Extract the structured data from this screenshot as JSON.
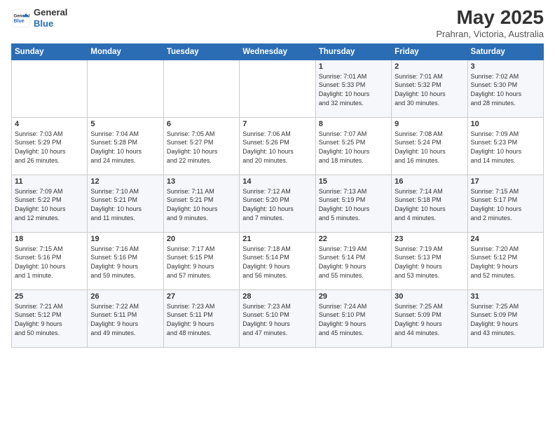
{
  "header": {
    "logo_general": "General",
    "logo_blue": "Blue",
    "month_title": "May 2025",
    "location": "Prahran, Victoria, Australia"
  },
  "days_of_week": [
    "Sunday",
    "Monday",
    "Tuesday",
    "Wednesday",
    "Thursday",
    "Friday",
    "Saturday"
  ],
  "weeks": [
    [
      {
        "day": "",
        "info": ""
      },
      {
        "day": "",
        "info": ""
      },
      {
        "day": "",
        "info": ""
      },
      {
        "day": "",
        "info": ""
      },
      {
        "day": "1",
        "info": "Sunrise: 7:01 AM\nSunset: 5:33 PM\nDaylight: 10 hours\nand 32 minutes."
      },
      {
        "day": "2",
        "info": "Sunrise: 7:01 AM\nSunset: 5:32 PM\nDaylight: 10 hours\nand 30 minutes."
      },
      {
        "day": "3",
        "info": "Sunrise: 7:02 AM\nSunset: 5:30 PM\nDaylight: 10 hours\nand 28 minutes."
      }
    ],
    [
      {
        "day": "4",
        "info": "Sunrise: 7:03 AM\nSunset: 5:29 PM\nDaylight: 10 hours\nand 26 minutes."
      },
      {
        "day": "5",
        "info": "Sunrise: 7:04 AM\nSunset: 5:28 PM\nDaylight: 10 hours\nand 24 minutes."
      },
      {
        "day": "6",
        "info": "Sunrise: 7:05 AM\nSunset: 5:27 PM\nDaylight: 10 hours\nand 22 minutes."
      },
      {
        "day": "7",
        "info": "Sunrise: 7:06 AM\nSunset: 5:26 PM\nDaylight: 10 hours\nand 20 minutes."
      },
      {
        "day": "8",
        "info": "Sunrise: 7:07 AM\nSunset: 5:25 PM\nDaylight: 10 hours\nand 18 minutes."
      },
      {
        "day": "9",
        "info": "Sunrise: 7:08 AM\nSunset: 5:24 PM\nDaylight: 10 hours\nand 16 minutes."
      },
      {
        "day": "10",
        "info": "Sunrise: 7:09 AM\nSunset: 5:23 PM\nDaylight: 10 hours\nand 14 minutes."
      }
    ],
    [
      {
        "day": "11",
        "info": "Sunrise: 7:09 AM\nSunset: 5:22 PM\nDaylight: 10 hours\nand 12 minutes."
      },
      {
        "day": "12",
        "info": "Sunrise: 7:10 AM\nSunset: 5:21 PM\nDaylight: 10 hours\nand 11 minutes."
      },
      {
        "day": "13",
        "info": "Sunrise: 7:11 AM\nSunset: 5:21 PM\nDaylight: 10 hours\nand 9 minutes."
      },
      {
        "day": "14",
        "info": "Sunrise: 7:12 AM\nSunset: 5:20 PM\nDaylight: 10 hours\nand 7 minutes."
      },
      {
        "day": "15",
        "info": "Sunrise: 7:13 AM\nSunset: 5:19 PM\nDaylight: 10 hours\nand 5 minutes."
      },
      {
        "day": "16",
        "info": "Sunrise: 7:14 AM\nSunset: 5:18 PM\nDaylight: 10 hours\nand 4 minutes."
      },
      {
        "day": "17",
        "info": "Sunrise: 7:15 AM\nSunset: 5:17 PM\nDaylight: 10 hours\nand 2 minutes."
      }
    ],
    [
      {
        "day": "18",
        "info": "Sunrise: 7:15 AM\nSunset: 5:16 PM\nDaylight: 10 hours\nand 1 minute."
      },
      {
        "day": "19",
        "info": "Sunrise: 7:16 AM\nSunset: 5:16 PM\nDaylight: 9 hours\nand 59 minutes."
      },
      {
        "day": "20",
        "info": "Sunrise: 7:17 AM\nSunset: 5:15 PM\nDaylight: 9 hours\nand 57 minutes."
      },
      {
        "day": "21",
        "info": "Sunrise: 7:18 AM\nSunset: 5:14 PM\nDaylight: 9 hours\nand 56 minutes."
      },
      {
        "day": "22",
        "info": "Sunrise: 7:19 AM\nSunset: 5:14 PM\nDaylight: 9 hours\nand 55 minutes."
      },
      {
        "day": "23",
        "info": "Sunrise: 7:19 AM\nSunset: 5:13 PM\nDaylight: 9 hours\nand 53 minutes."
      },
      {
        "day": "24",
        "info": "Sunrise: 7:20 AM\nSunset: 5:12 PM\nDaylight: 9 hours\nand 52 minutes."
      }
    ],
    [
      {
        "day": "25",
        "info": "Sunrise: 7:21 AM\nSunset: 5:12 PM\nDaylight: 9 hours\nand 50 minutes."
      },
      {
        "day": "26",
        "info": "Sunrise: 7:22 AM\nSunset: 5:11 PM\nDaylight: 9 hours\nand 49 minutes."
      },
      {
        "day": "27",
        "info": "Sunrise: 7:23 AM\nSunset: 5:11 PM\nDaylight: 9 hours\nand 48 minutes."
      },
      {
        "day": "28",
        "info": "Sunrise: 7:23 AM\nSunset: 5:10 PM\nDaylight: 9 hours\nand 47 minutes."
      },
      {
        "day": "29",
        "info": "Sunrise: 7:24 AM\nSunset: 5:10 PM\nDaylight: 9 hours\nand 45 minutes."
      },
      {
        "day": "30",
        "info": "Sunrise: 7:25 AM\nSunset: 5:09 PM\nDaylight: 9 hours\nand 44 minutes."
      },
      {
        "day": "31",
        "info": "Sunrise: 7:25 AM\nSunset: 5:09 PM\nDaylight: 9 hours\nand 43 minutes."
      }
    ]
  ]
}
